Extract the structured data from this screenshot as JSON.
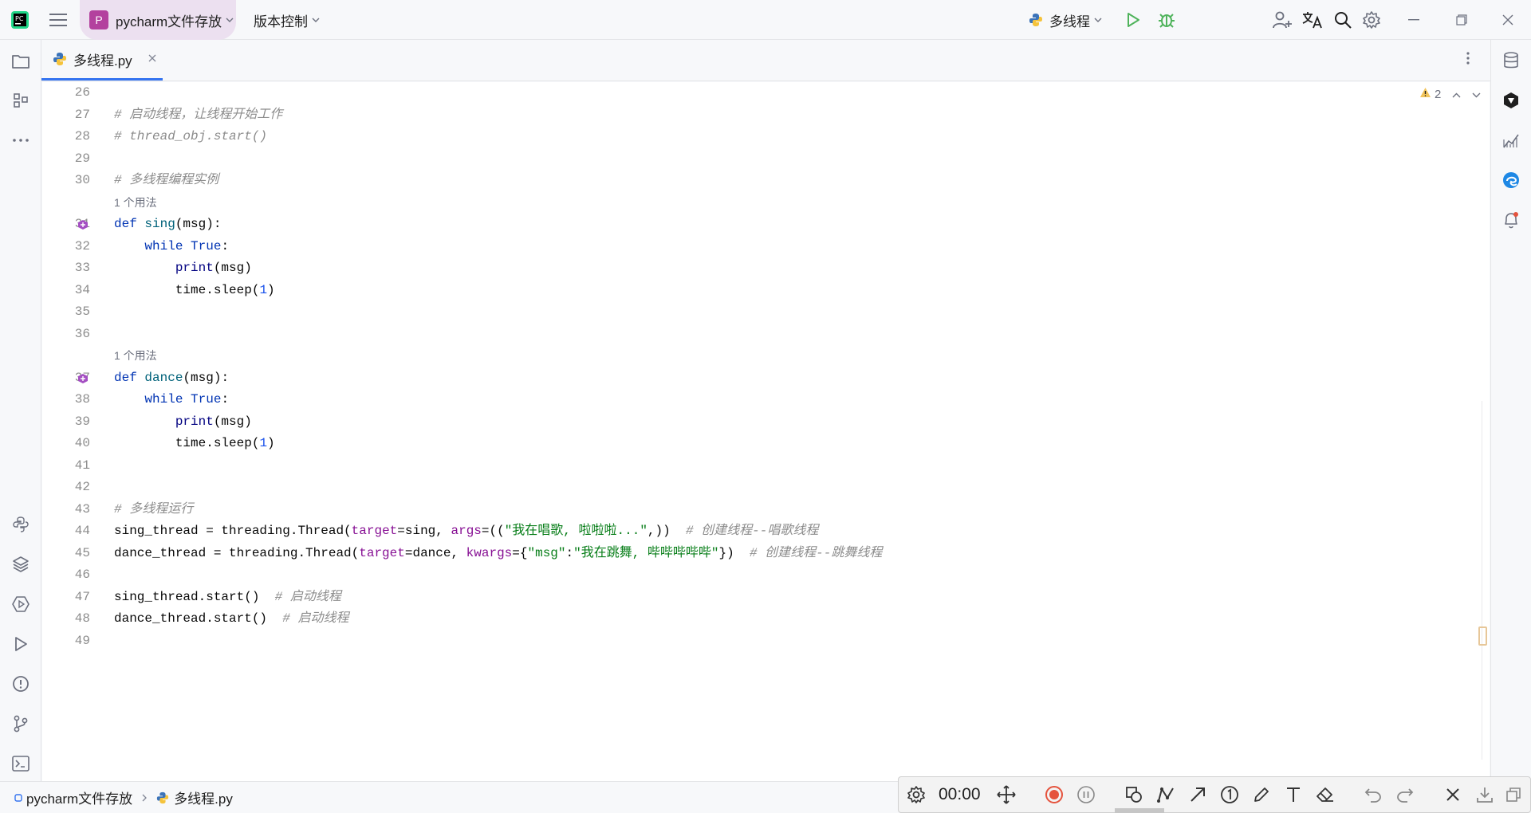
{
  "titlebar": {
    "project_initial": "P",
    "project_name": "pycharm文件存放",
    "vcs_label": "版本控制",
    "run_config": "多线程"
  },
  "tabs": [
    {
      "label": "多线程.py",
      "active": true
    }
  ],
  "editor": {
    "inspection_count": "2",
    "usage_hint": "1 个用法",
    "line_numbers": [
      "26",
      "27",
      "28",
      "29",
      "30",
      "31",
      "32",
      "33",
      "34",
      "35",
      "36",
      "37",
      "38",
      "39",
      "40",
      "41",
      "42",
      "43",
      "44",
      "45",
      "46",
      "47",
      "48",
      "49"
    ],
    "lines": {
      "l27": "# 启动线程，让线程开始工作",
      "l28": "# thread_obj.start()",
      "l30": "# 多线程编程实例",
      "l31_kw": "def",
      "l31_fn": "sing",
      "l31_rest": "(msg):",
      "l32_kw": "while",
      "l32_true": "True",
      "l32_colon": ":",
      "l33_fn": "print",
      "l33_rest": "(msg)",
      "l34_a": "time.sleep(",
      "l34_num": "1",
      "l34_b": ")",
      "l37_kw": "def",
      "l37_fn": "dance",
      "l37_rest": "(msg):",
      "l38_kw": "while",
      "l38_true": "True",
      "l38_colon": ":",
      "l39_fn": "print",
      "l39_rest": "(msg)",
      "l40_a": "time.sleep(",
      "l40_num": "1",
      "l40_b": ")",
      "l43": "# 多线程运行",
      "l44_a": "sing_thread = threading.Thread(",
      "l44_p1": "target",
      "l44_b": "=sing, ",
      "l44_p2": "args",
      "l44_c": "=((",
      "l44_str": "\"我在唱歌, 啦啦啦...\"",
      "l44_d": ",))  ",
      "l44_cm": "# 创建线程--唱歌线程",
      "l45_a": "dance_thread = threading.Thread(",
      "l45_p1": "target",
      "l45_b": "=dance, ",
      "l45_p2": "kwargs",
      "l45_c": "={",
      "l45_key": "\"msg\"",
      "l45_colon": ":",
      "l45_str": "\"我在跳舞, 哔哔哔哔哔\"",
      "l45_d": "})  ",
      "l45_cm": "# 创建线程--跳舞线程",
      "l47_a": "sing_thread.start()  ",
      "l47_cm": "# 启动线程",
      "l48_a": "dance_thread.start()  ",
      "l48_cm": "# 启动线程"
    }
  },
  "statusbar": {
    "project": "pycharm文件存放",
    "file": "多线程.py"
  },
  "recorder": {
    "time": "00:00"
  },
  "colors": {
    "accent": "#3574f0",
    "project_badge": "#b3419e",
    "run_green": "#4fb35b",
    "record_red": "#e5533d"
  }
}
